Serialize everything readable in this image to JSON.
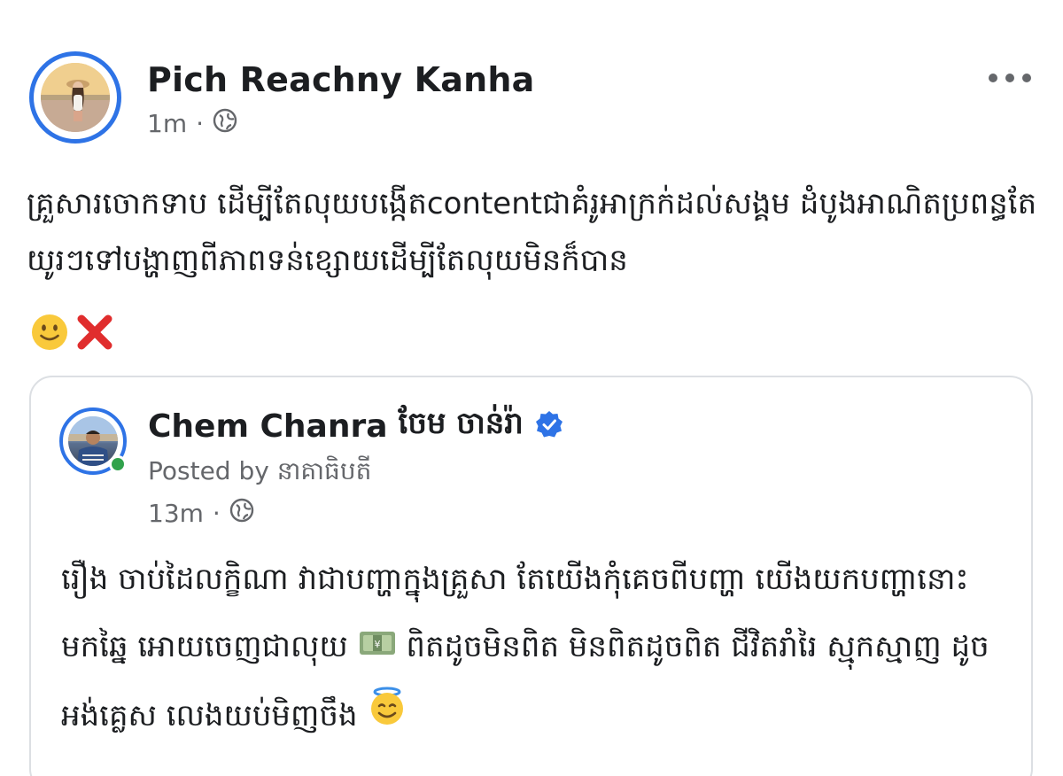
{
  "post": {
    "author": "Pich Reachny Kanha",
    "time": "1m",
    "separator": "·",
    "audience_icon": "globe-icon",
    "more_icon": "more-horizontal-icon",
    "text": "គ្រួសារចោកទាប ដើម្បីតែលុយបង្កើតcontentជាគំរូអាក្រក់ដល់សង្គម ដំបូងអាណិតប្រពន្ធតែ យូរៗទៅបង្ហាញពីភាពទន់ខ្សោយដើម្បីតែលុយមិនក៏បាន",
    "emojis": [
      "slightly-smiling-face-icon",
      "cross-mark-icon"
    ]
  },
  "shared": {
    "author": "Chem Chanra",
    "author_khmer": "ចែម ចាន់រ៉ា",
    "verified_icon": "verified-badge-icon",
    "posted_by": "Posted by នាគាធិបតី",
    "time": "13m",
    "separator": "·",
    "audience_icon": "globe-icon",
    "text_part1": "រឿង ចាប់ដៃលក្ខិណា វាជាបញ្ហាក្នុងគ្រួសា តែយើងកុំគេចពីបញ្ហា យើងយកបញ្ហានោះ មកឆ្នៃ អោយចេញជាលុយ ",
    "text_part2": " ពិតដូចមិនពិត មិនពិតដូចពិត ជីវិតរាំរៃ ស្មុកស្មាញ ដូចអង់គ្លេស លេងយប់មិញចឹង ",
    "money_icon": "money-bill-icon",
    "halo_icon": "smiling-face-with-halo-icon"
  },
  "colors": {
    "accent": "#2e73e6",
    "online": "#31a24c",
    "text": "#1c1e21",
    "meta": "#65676b"
  }
}
